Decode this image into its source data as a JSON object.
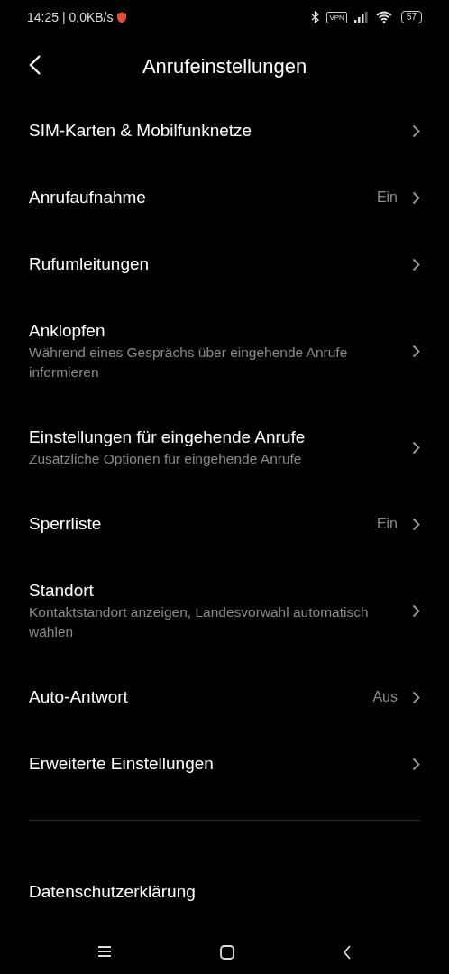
{
  "status_bar": {
    "time": "14:25 | 0,0KB/s",
    "vpn": "VPN",
    "battery": "57"
  },
  "header": {
    "title": "Anrufeinstellungen"
  },
  "settings": [
    {
      "title": "SIM-Karten & Mobilfunknetze"
    },
    {
      "title": "Anrufaufnahme",
      "value": "Ein"
    },
    {
      "title": "Rufumleitungen"
    },
    {
      "title": "Anklopfen",
      "subtitle": "Während eines Gesprächs über eingehende Anrufe informieren"
    },
    {
      "title": "Einstellungen für eingehende Anrufe",
      "subtitle": "Zusätzliche Optionen für eingehende Anrufe"
    },
    {
      "title": "Sperrliste",
      "value": "Ein"
    },
    {
      "title": "Standort",
      "subtitle": "Kontaktstandort anzeigen, Landesvorwahl automatisch wählen"
    },
    {
      "title": "Auto-Antwort",
      "value": "Aus"
    },
    {
      "title": "Erweiterte Einstellungen"
    }
  ],
  "footer_items": [
    {
      "title": "Datenschutzerklärung"
    }
  ]
}
